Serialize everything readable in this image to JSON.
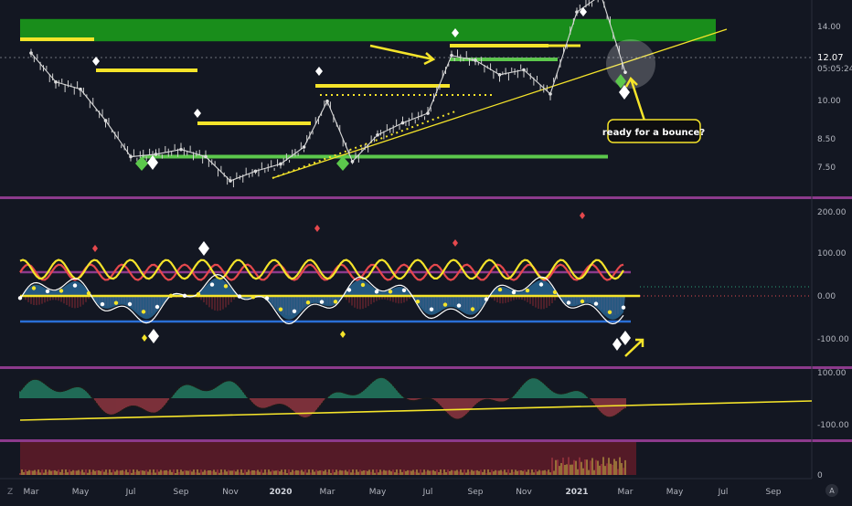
{
  "chart_data": {
    "type": "line",
    "time_axis": [
      "Mar",
      "May",
      "Jul",
      "Sep",
      "Nov",
      "2020",
      "Mar",
      "May",
      "Jul",
      "Sep",
      "Nov",
      "2021",
      "Mar",
      "May",
      "Jul",
      "Sep"
    ],
    "panels": [
      {
        "name": "price",
        "y_ticks": [
          "14.00",
          "12.00",
          "10.00",
          "8.50",
          "7.50"
        ],
        "last_price": "12.07",
        "countdown": "05:05:24",
        "annotation": "ready for a bounce?",
        "series": [
          {
            "x": [
              "2019-03",
              "2019-04",
              "2019-05",
              "2019-06",
              "2019-07",
              "2019-08",
              "2019-09",
              "2019-10",
              "2019-11",
              "2019-12",
              "2020-01",
              "2020-02",
              "2020-03",
              "2020-04",
              "2020-05",
              "2020-06",
              "2020-07",
              "2020-08",
              "2020-09",
              "2020-10",
              "2020-11",
              "2020-12",
              "2021-01",
              "2021-02",
              "2021-03"
            ],
            "values": [
              12.9,
              11.7,
              11.4,
              10.1,
              8.6,
              8.7,
              8.9,
              8.6,
              7.6,
              8.0,
              8.3,
              9.0,
              10.9,
              8.4,
              9.5,
              10.0,
              10.4,
              12.8,
              12.6,
              12.0,
              12.2,
              11.2,
              14.6,
              15.3,
              12.1
            ]
          }
        ],
        "zones": [
          {
            "from": 13.5,
            "to": 14.5,
            "color": "#1b9a1b"
          }
        ],
        "support_line": 8.6,
        "accent": "#f5e42a"
      },
      {
        "name": "oscillator",
        "y_ticks": [
          "200.00",
          "100.00",
          "0.00",
          "-100.00"
        ]
      },
      {
        "name": "momentum",
        "y_ticks": [
          "100.00",
          "-100.00"
        ]
      },
      {
        "name": "volume",
        "y_ticks": [
          "0"
        ]
      }
    ],
    "colors": {
      "background": "#131722",
      "green_zone": "#1b9a1b",
      "yellow": "#f5e42a",
      "green_line": "#5cc84c",
      "red": "#e5484d",
      "blue": "#2a6fd6",
      "teal": "#2aa37a",
      "purple_border": "#8c3a8c"
    }
  }
}
